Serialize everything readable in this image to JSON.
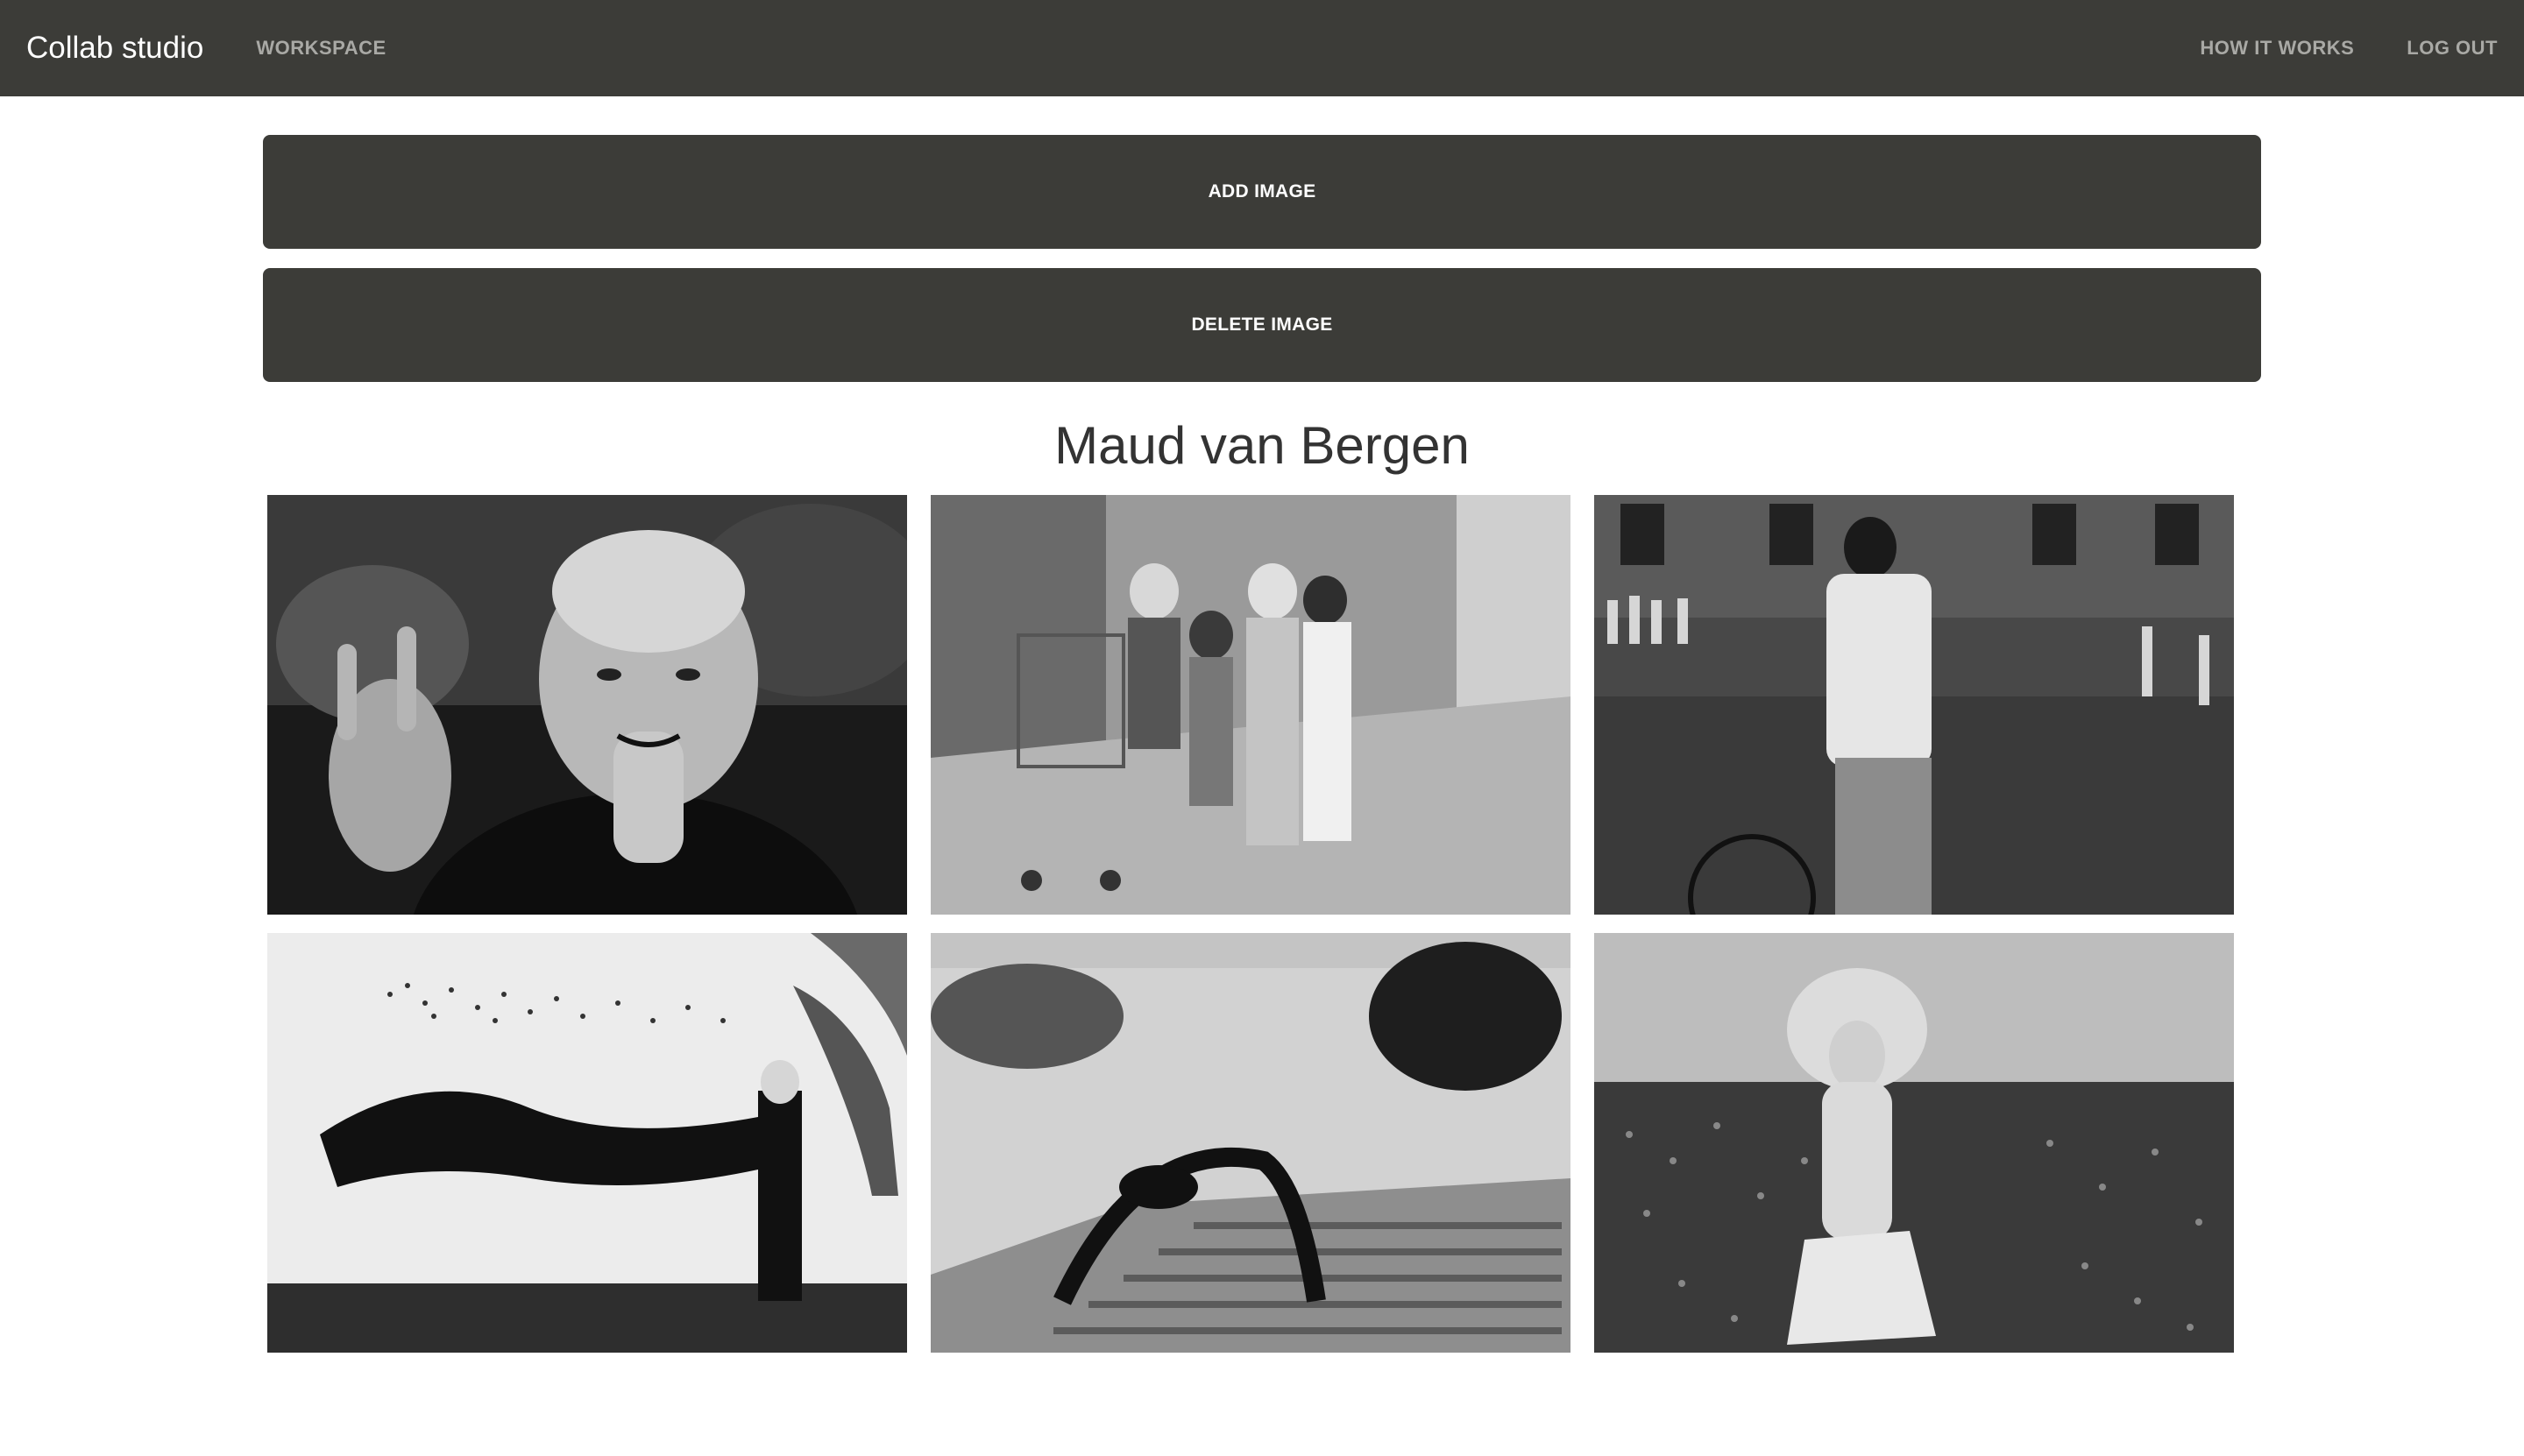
{
  "nav": {
    "brand": "Collab studio",
    "workspace": "WORKSPACE",
    "how_it_works": "HOW IT WORKS",
    "log_out": "LOG OUT"
  },
  "actions": {
    "add": "ADD IMAGE",
    "delete": "DELETE IMAGE"
  },
  "gallery": {
    "title": "Maud van Bergen",
    "images": [
      {
        "subject": "portrait of smiling bearded man waving"
      },
      {
        "subject": "children posing with shopping cart on wet street"
      },
      {
        "subject": "young man with bicycle on flooded street"
      },
      {
        "subject": "woman with flowing fabric and flock of birds"
      },
      {
        "subject": "dancer in backbend on grated platform by rocks"
      },
      {
        "subject": "woman standing in field of flowers"
      }
    ]
  },
  "colors": {
    "navbar": "#3c3c38",
    "button": "#3c3c38",
    "nav_link": "#a9a9a5"
  }
}
